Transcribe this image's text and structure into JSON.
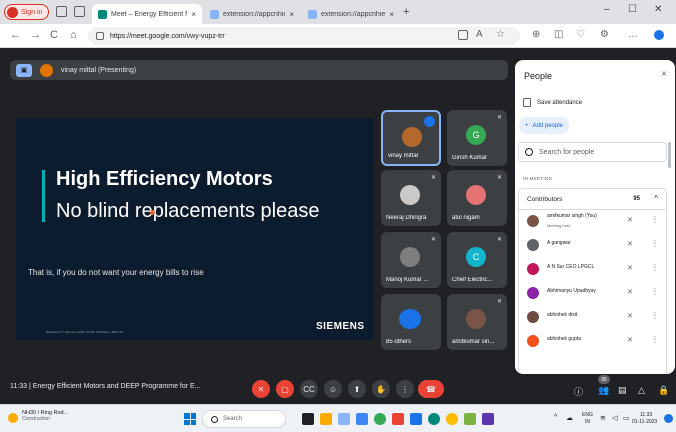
{
  "browser": {
    "signin_label": "Sign in",
    "tabs": [
      {
        "title": "Meet – Energy Efficient Mo",
        "active": true,
        "favicon_color": "#00897b"
      },
      {
        "title": "extension://appcnhiefcidcdjeci",
        "active": false,
        "favicon_color": "#8ab4f8"
      },
      {
        "title": "extension://appcnhiefcidcdjeci",
        "active": false,
        "favicon_color": "#8ab4f8"
      }
    ],
    "tab_close": "×",
    "new_tab": "+",
    "window_controls": {
      "minimize": "–",
      "maximize": "☐",
      "close": "✕"
    },
    "nav": {
      "back": "←",
      "forward": "→",
      "reload": "C",
      "home": "⌂"
    },
    "url": "https://meet.google.com/vwy-vupz-trr",
    "toolbar_icons": [
      "A",
      "☆",
      "⊕",
      "◫",
      "♡",
      "⚙",
      "…"
    ]
  },
  "meet": {
    "presenter_label": "vinay mittal (Presenting)",
    "slide": {
      "title": "High Efficiency Motors",
      "subtitle": "No blind replacements please",
      "body": "That is, if you do not want your energy bills to rise",
      "footer": "Restricted | © Siemens 2023 | DI MC LV-Motors | 2023-10",
      "logo": "SIEMENS"
    },
    "tiles": [
      {
        "name": "vinay mittal",
        "avatar_color": "#b3692c",
        "speaking": true
      },
      {
        "name": "Girish Kumar",
        "avatar_color": "#34a853",
        "initial": "G"
      },
      {
        "name": "Neeraj Dhingra",
        "avatar_color": "#c9c9c9"
      },
      {
        "name": "atul nigam",
        "avatar_color": "#e57373"
      },
      {
        "name": "Manoj Kumar ...",
        "avatar_color": "#7e7e7e"
      },
      {
        "name": "Chief Electric...",
        "avatar_color": "#12b5cb",
        "initial": "C"
      },
      {
        "name": "85 others",
        "avatar_color": "#1a73e8"
      },
      {
        "name": "amitkumar sin...",
        "avatar_color": "#795548"
      }
    ],
    "mic_off_icon": "🎙",
    "bottom": {
      "time": "11:33",
      "separator": "|",
      "meeting_title": "Energy Efficient Motors and DEEP Programme for E...",
      "participant_badge": "95"
    }
  },
  "people": {
    "title": "People",
    "close": "×",
    "save_attendance": "Save attendance",
    "add_people": "Add people",
    "search_placeholder": "Search for people",
    "section": "IN MEETING",
    "group_label": "Contributors",
    "group_count": "95",
    "group_chevron": "^",
    "rows": [
      {
        "name": "amitkumar singh (You)",
        "sub": "Meeting host",
        "color": "#795548"
      },
      {
        "name": "A gangwar",
        "sub": "",
        "color": "#5f6368"
      },
      {
        "name": "A N Sar CEO LPGCL",
        "sub": "",
        "color": "#c2185b"
      },
      {
        "name": "Abhimanyu Upadhyay",
        "sub": "",
        "color": "#8e24aa"
      },
      {
        "name": "abhishek dixit",
        "sub": "",
        "color": "#6d4c41"
      },
      {
        "name": "abhishek gupta",
        "sub": "",
        "color": "#f4511e"
      }
    ],
    "more": "⋮"
  },
  "taskbar": {
    "weather_line1": "NH30 / Ring Rod...",
    "weather_line2": "Construction",
    "search_label": "Search",
    "lang_line1": "ENG",
    "lang_line2": "IN",
    "clock_time": "11:33",
    "clock_date": "01-11-2023"
  }
}
